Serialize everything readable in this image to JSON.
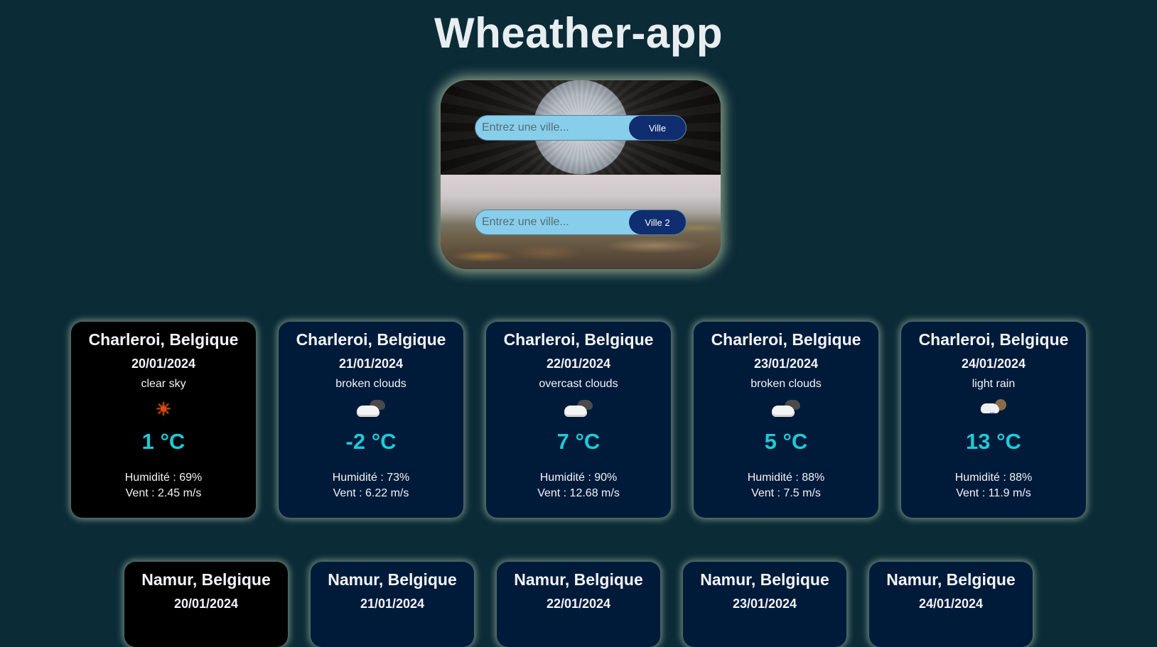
{
  "app": {
    "title": "Wheather-app"
  },
  "search": {
    "city1": {
      "placeholder": "Entrez une ville...",
      "value": "",
      "button_label": "Ville"
    },
    "city2": {
      "placeholder": "Entrez une ville...",
      "value": "",
      "button_label": "Ville 2"
    }
  },
  "colors": {
    "background": "#0b2b37",
    "card_background": "#001a3a",
    "card_today_background": "#000000",
    "temperature": "#1fc9d5",
    "search_input": "#87ceeb",
    "search_button": "#0f2d6f",
    "glow": "#e1f0be"
  },
  "forecast_city1": [
    {
      "city": "Charleroi, Belgique",
      "date": "20/01/2024",
      "description": "clear sky",
      "icon": "sun-icon",
      "temperature": "1 °C",
      "humidity": "Humidité : 69%",
      "wind": "Vent : 2.45 m/s"
    },
    {
      "city": "Charleroi, Belgique",
      "date": "21/01/2024",
      "description": "broken clouds",
      "icon": "cloud-icon",
      "temperature": "-2 °C",
      "humidity": "Humidité : 73%",
      "wind": "Vent : 6.22 m/s"
    },
    {
      "city": "Charleroi, Belgique",
      "date": "22/01/2024",
      "description": "overcast clouds",
      "icon": "cloud-icon",
      "temperature": "7 °C",
      "humidity": "Humidité : 90%",
      "wind": "Vent : 12.68 m/s"
    },
    {
      "city": "Charleroi, Belgique",
      "date": "23/01/2024",
      "description": "broken clouds",
      "icon": "cloud-icon",
      "temperature": "5 °C",
      "humidity": "Humidité : 88%",
      "wind": "Vent : 7.5 m/s"
    },
    {
      "city": "Charleroi, Belgique",
      "date": "24/01/2024",
      "description": "light rain",
      "icon": "rain-icon",
      "temperature": "13 °C",
      "humidity": "Humidité : 88%",
      "wind": "Vent : 11.9 m/s"
    }
  ],
  "forecast_city2": [
    {
      "city": "Namur, Belgique",
      "date": "20/01/2024"
    },
    {
      "city": "Namur, Belgique",
      "date": "21/01/2024"
    },
    {
      "city": "Namur, Belgique",
      "date": "22/01/2024"
    },
    {
      "city": "Namur, Belgique",
      "date": "23/01/2024"
    },
    {
      "city": "Namur, Belgique",
      "date": "24/01/2024"
    }
  ]
}
